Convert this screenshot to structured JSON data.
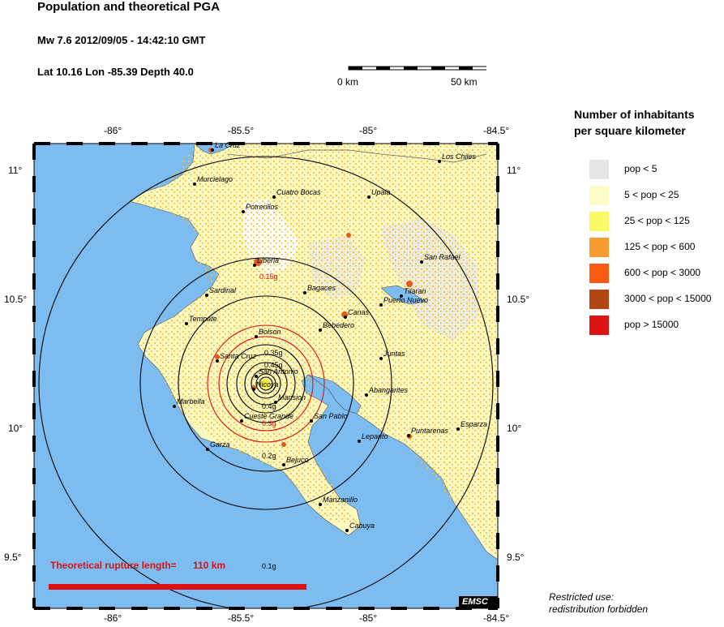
{
  "header": {
    "title": "Population and theoretical PGA",
    "event_line": "Mw 7.6  2012/09/05 - 14:42:10 GMT",
    "location_line": "Lat 10.16    Lon -85.39     Depth  40.0"
  },
  "scale_bar": {
    "start_label": "0 km",
    "end_label": "50 km"
  },
  "axes": {
    "x_ticks": [
      "-86°",
      "-85.5°",
      "-85°",
      "-84.5°"
    ],
    "y_ticks": [
      "11°",
      "10.5°",
      "10°",
      "9.5°"
    ]
  },
  "places": [
    {
      "name": "La Cruz"
    },
    {
      "name": "Los Chiles"
    },
    {
      "name": "Murcielago"
    },
    {
      "name": "Cuatro Bocas"
    },
    {
      "name": "Upala"
    },
    {
      "name": "Potrerillos"
    },
    {
      "name": "San Rafael"
    },
    {
      "name": "Liberia"
    },
    {
      "name": "Sardinal"
    },
    {
      "name": "Bagaces"
    },
    {
      "name": "Tilaran"
    },
    {
      "name": "Puerto Nuevo"
    },
    {
      "name": "Canas"
    },
    {
      "name": "Tempate"
    },
    {
      "name": "Bebedero"
    },
    {
      "name": "Bolson"
    },
    {
      "name": "Santa Cruz"
    },
    {
      "name": "Juntas"
    },
    {
      "name": "San Antonio"
    },
    {
      "name": "Nicoya"
    },
    {
      "name": "Mansion"
    },
    {
      "name": "Abangarites"
    },
    {
      "name": "Marbella"
    },
    {
      "name": "Cueste Grande"
    },
    {
      "name": "San Pablo"
    },
    {
      "name": "Puntarenas"
    },
    {
      "name": "Esparza"
    },
    {
      "name": "Lepanto"
    },
    {
      "name": "Garza"
    },
    {
      "name": "Bejuco"
    },
    {
      "name": "Manzanillo"
    },
    {
      "name": "Cabuya"
    }
  ],
  "pga_labels": [
    "0.15g",
    "0.35g",
    "0.45g",
    "0.4g",
    "0.3g",
    "0.2g",
    "0.1g"
  ],
  "rupture": {
    "label": "Theoretical rupture length=",
    "value": "110 km"
  },
  "logo": "EMSC",
  "legend": {
    "title_line1": "Number of inhabitants",
    "title_line2": "per square kilometer",
    "items": [
      {
        "label": "pop < 5",
        "color": "#e6e6e6"
      },
      {
        "label": "5 < pop < 25",
        "color": "#fcfcc8"
      },
      {
        "label": "25 < pop < 125",
        "color": "#fafa64"
      },
      {
        "label": "125 < pop < 600",
        "color": "#fa9b32"
      },
      {
        "label": "600 < pop < 3000",
        "color": "#fa5a14"
      },
      {
        "label": "3000 < pop < 15000",
        "color": "#b44614"
      },
      {
        "label": "pop > 15000",
        "color": "#dc1414"
      }
    ]
  },
  "restricted": {
    "line1": "Restricted use:",
    "line2": "redistribution forbidden"
  },
  "colors": {
    "ocean": "#7cbcf0",
    "land": "#fbf8c0",
    "rupture": "#dd1111",
    "pga_red": "#dd1111"
  }
}
